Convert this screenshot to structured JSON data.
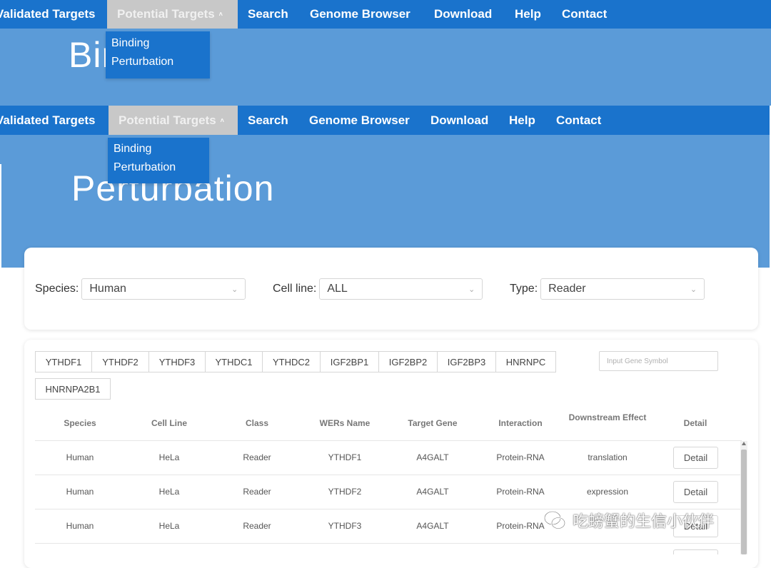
{
  "nav": {
    "items": [
      "Validated Targets",
      "Potential Targets",
      "Search",
      "Genome Browser",
      "Download",
      "Help",
      "Contact"
    ],
    "active": "Potential Targets",
    "dropdown": [
      "Binding",
      "Perturbation"
    ]
  },
  "hero": {
    "title_1": "Binding",
    "title_2": "Perturbation"
  },
  "filters": {
    "species_label": "Species:",
    "species_value": "Human",
    "cell_line_label": "Cell line:",
    "cell_line_value": "ALL",
    "type_label": "Type:",
    "type_value": "Reader"
  },
  "tabs": [
    "YTHDF1",
    "YTHDF2",
    "YTHDF3",
    "YTHDC1",
    "YTHDC2",
    "IGF2BP1",
    "IGF2BP2",
    "IGF2BP3",
    "HNRNPC",
    "HNRNPA2B1"
  ],
  "gene_input": {
    "placeholder": "Input Gene Symbol"
  },
  "table": {
    "headers": [
      "Species",
      "Cell Line",
      "Class",
      "WERs Name",
      "Target Gene",
      "Interaction",
      "Downstream Effect",
      "Detail"
    ],
    "rows": [
      [
        "Human",
        "HeLa",
        "Reader",
        "YTHDF1",
        "A4GALT",
        "Protein-RNA",
        "translation",
        "Detail"
      ],
      [
        "Human",
        "HeLa",
        "Reader",
        "YTHDF2",
        "A4GALT",
        "Protein-RNA",
        "expression",
        "Detail"
      ],
      [
        "Human",
        "HeLa",
        "Reader",
        "YTHDF3",
        "A4GALT",
        "Protein-RNA",
        "",
        "Detail"
      ]
    ]
  },
  "watermark": {
    "text": "吃螃蟹的生信小伙伴"
  },
  "colors": {
    "nav": "#1a73cc",
    "hero": "#5b9bd8",
    "active_tab": "#c8c8c8"
  },
  "icons": {
    "dropdown_caret": "chevron-up-icon",
    "select_chevron": "chevron-down-icon",
    "watermark": "wechat-icon"
  }
}
